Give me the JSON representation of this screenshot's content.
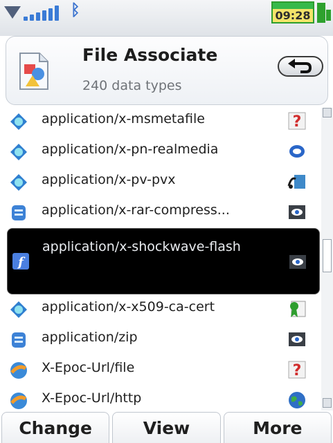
{
  "status": {
    "time": "09:28",
    "signal_icon": "signal-bars-icon",
    "bluetooth_icon": "bluetooth-icon",
    "battery_icon": "battery-icon"
  },
  "header": {
    "title": "File Associate",
    "subtitle": "240 data types",
    "app_icon": "file-associate-app-icon",
    "back_icon": "back-arrow-icon"
  },
  "list": {
    "items": [
      {
        "label": "application/x-msmetafile",
        "type_icon": "diamond-globe-icon",
        "app_icon": "question-mark-icon"
      },
      {
        "label": "application/x-pn-realmedia",
        "type_icon": "diamond-globe-icon",
        "app_icon": "realplayer-icon"
      },
      {
        "label": "application/x-pv-pvx",
        "type_icon": "diamond-globe-icon",
        "app_icon": "media-player-icon"
      },
      {
        "label": "application/x-rar-compress...",
        "type_icon": "archive-icon",
        "app_icon": "viewer-eye-icon"
      },
      {
        "label": "application/x-shockwave-flash",
        "type_icon": "flash-icon",
        "app_icon": "viewer-eye-icon",
        "selected": true
      },
      {
        "label": "application/x-x509-ca-cert",
        "type_icon": "diamond-globe-icon",
        "app_icon": "certificate-icon"
      },
      {
        "label": "application/zip",
        "type_icon": "archive-icon",
        "app_icon": "viewer-eye-icon"
      },
      {
        "label": "X-Epoc-Url/file",
        "type_icon": "url-scheme-icon",
        "app_icon": "question-mark-icon"
      },
      {
        "label": "X-Epoc-Url/http",
        "type_icon": "url-scheme-icon",
        "app_icon": "globe-icon"
      }
    ]
  },
  "softkeys": {
    "left": "Change",
    "middle": "View",
    "right": "More"
  },
  "colors": {
    "selection_bg": "#000000",
    "accent_blue": "#3a7bd6",
    "battery_green": "#37b94a",
    "clock_yellow": "#f3e46a"
  }
}
